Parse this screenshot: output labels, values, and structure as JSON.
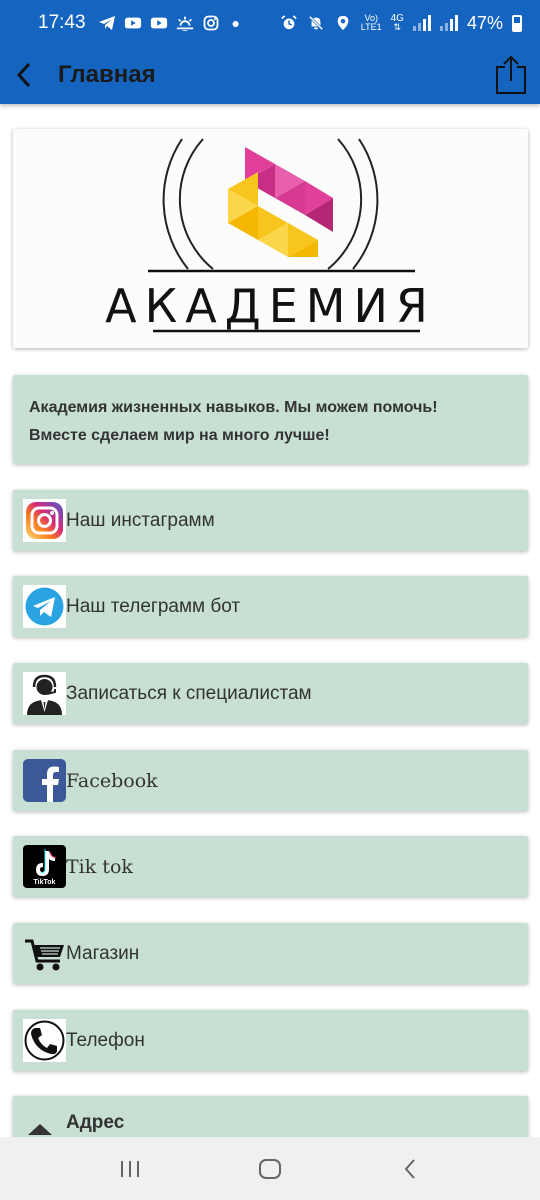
{
  "status_bar": {
    "time": "17:43",
    "left_icons": [
      "telegram-icon",
      "youtube-icon",
      "youtube-icon",
      "weather-icon",
      "instagram-icon",
      "dot-icon"
    ],
    "right_icons": [
      "alarm-icon",
      "mute-icon",
      "location-icon",
      "volte-icon",
      "4g-icon",
      "signal-icon",
      "signal-icon"
    ],
    "net_top": "Vo)",
    "net_bottom": "LTE1",
    "net_gen": "4G",
    "battery": "47%"
  },
  "app_bar": {
    "title": "Главная",
    "back_icon": "chevron-left-icon",
    "share_icon": "share-icon",
    "background": "#1565c0"
  },
  "logo": {
    "wordmark": "АКАДЕМИЯ",
    "colors": {
      "magenta": "#d63a93",
      "yellow": "#f8c51c"
    }
  },
  "about": {
    "line1": "Академия жизненных навыков. Мы можем помочь!",
    "line2": "Вместе сделаем мир на много лучше!"
  },
  "links": [
    {
      "label": "Наш инстаграмм",
      "icon": "instagram-icon"
    },
    {
      "label": "Наш телеграмм бот",
      "icon": "telegram-icon"
    },
    {
      "label": "Записаться к специалистам",
      "icon": "support-agent-icon"
    },
    {
      "label": "Facebook",
      "icon": "facebook-icon"
    },
    {
      "label": "Tik tok",
      "icon": "tiktok-icon",
      "icon_text": "TikTok"
    },
    {
      "label": "Магазин",
      "icon": "shopping-cart-icon"
    },
    {
      "label": "Телефон",
      "icon": "phone-icon"
    }
  ],
  "address": {
    "label": "Адрес",
    "icon": "chevron-up-icon"
  },
  "card_color": "#c7e0d3",
  "nav_bar": {
    "buttons": [
      "recent-apps-icon",
      "home-icon",
      "back-icon"
    ]
  }
}
